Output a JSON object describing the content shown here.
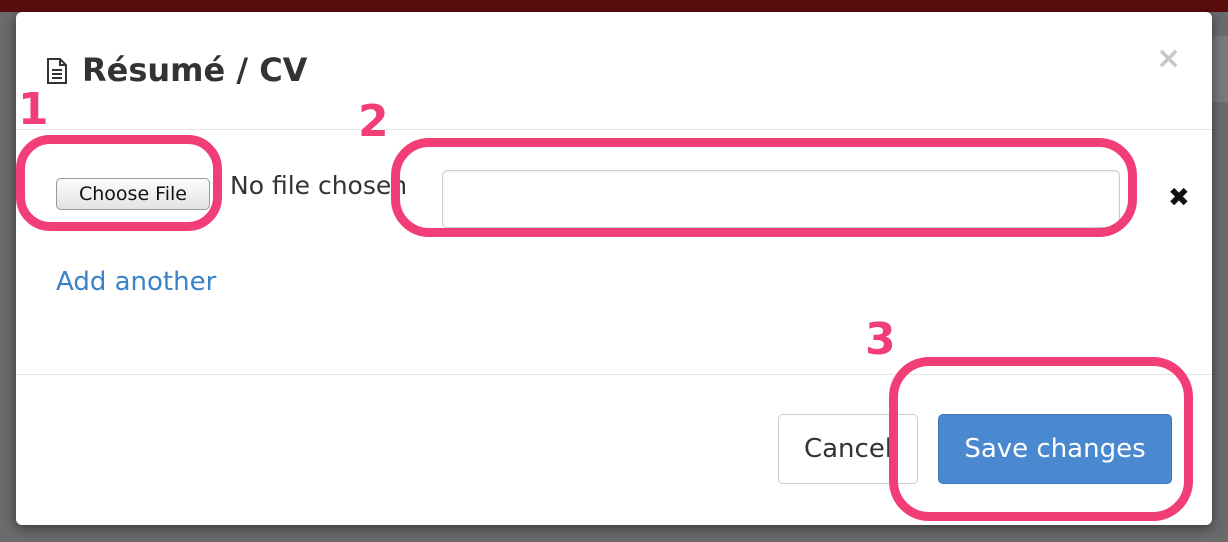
{
  "dialog": {
    "title": "Résumé / CV",
    "title_icon": "document-icon",
    "close_symbol": "×"
  },
  "upload": {
    "choose_file_label": "Choose File",
    "file_status": "No file chosen",
    "description_value": "",
    "remove_symbol": "✖",
    "add_another_label": "Add another"
  },
  "footer": {
    "cancel_label": "Cancel",
    "save_label": "Save changes"
  },
  "annotations": {
    "step1": "1",
    "step2": "2",
    "step3": "3"
  },
  "colors": {
    "accent": "#f23e77",
    "primary": "#4a89cf",
    "link": "#3b82c8"
  }
}
